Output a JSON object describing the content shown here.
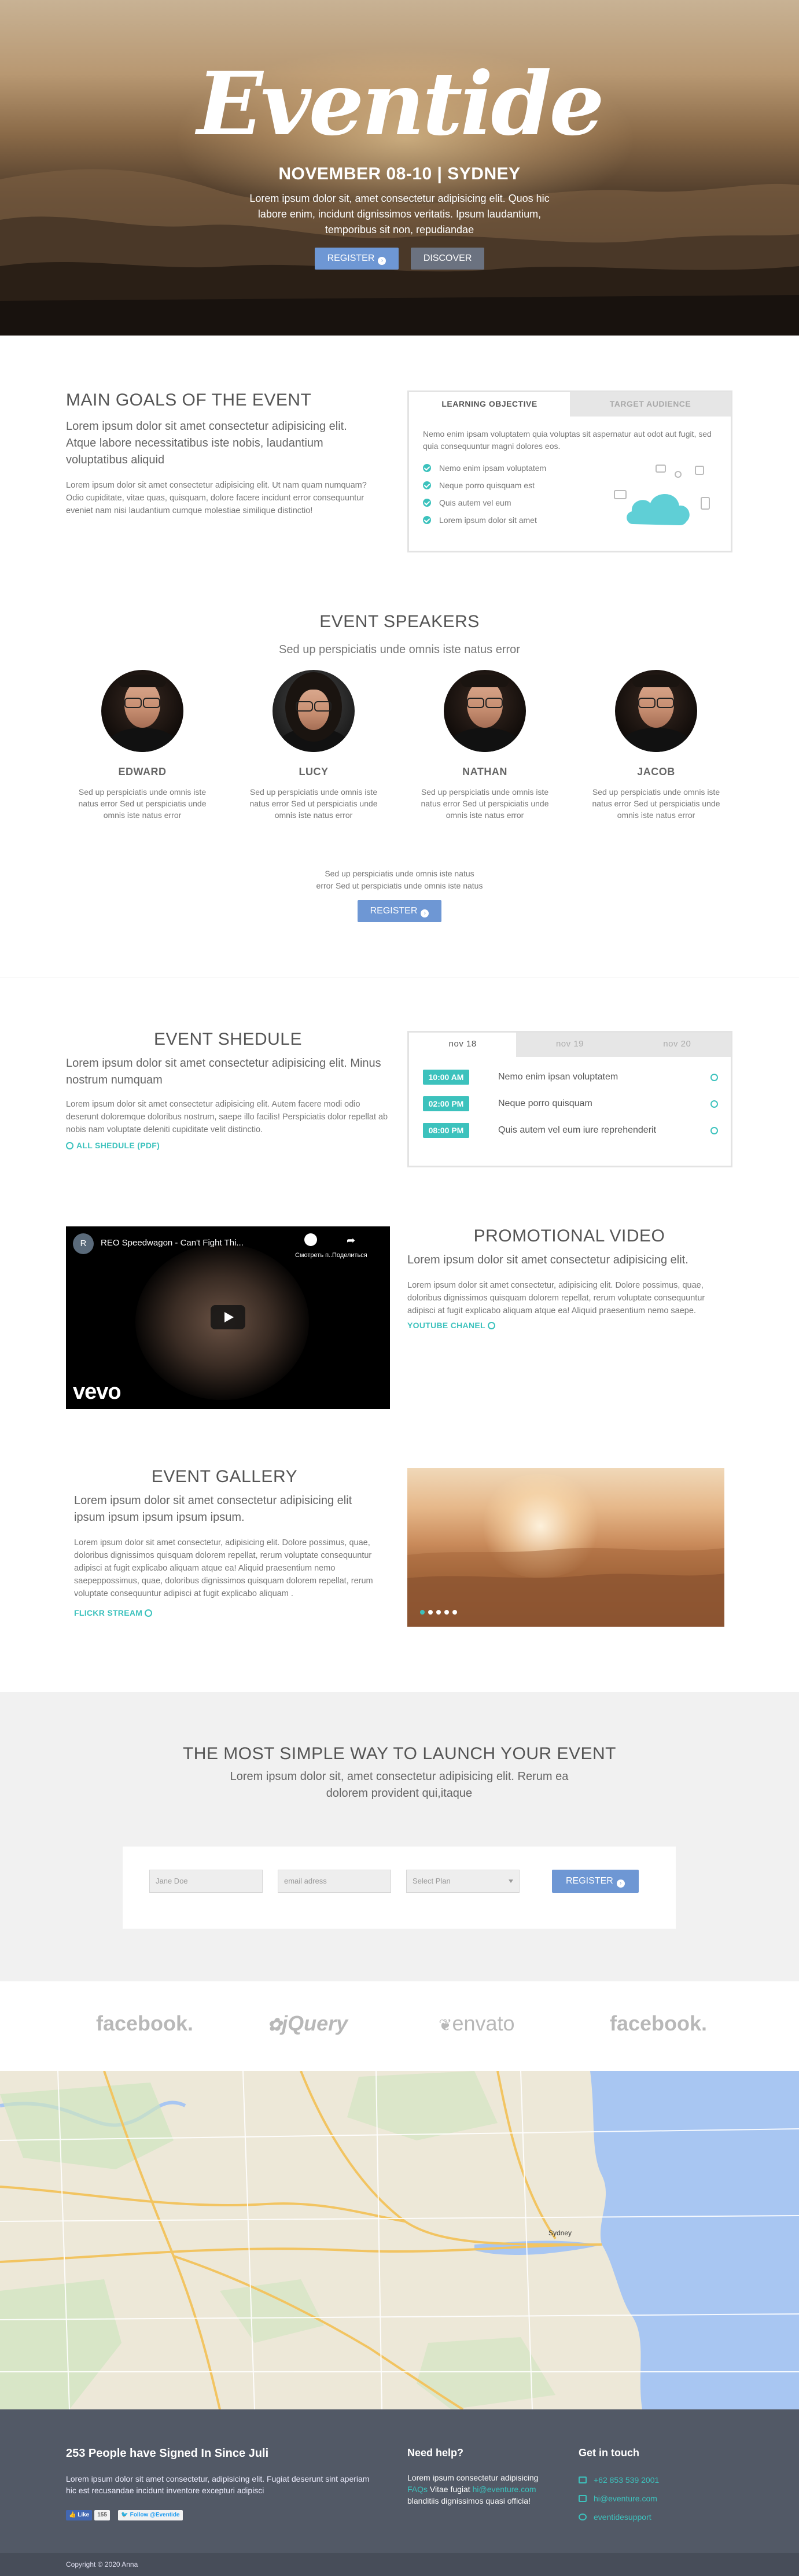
{
  "hero": {
    "logo": "Eventide",
    "date": "NOVEMBER 08-10 | SYDNEY",
    "subtitle": "Lorem ipsum dolor sit, amet consectetur adipisicing elit. Quos hic labore enim, incidunt dignissimos veritatis. Ipsum laudantium, temporibus sit non, repudiandae",
    "register": "REGISTER",
    "discover": "DISCOVER"
  },
  "goals": {
    "title": "MAIN GOALS OF THE EVENT",
    "lead": "Lorem ipsum dolor sit amet consectetur adipisicing elit. Atque labore necessitatibus iste nobis, laudantium voluptatibus aliquid",
    "body": "Lorem ipsum dolor sit amet consectetur adipisicing elit. Ut nam quam numquam? Odio cupiditate, vitae quas, quisquam, dolore facere incidunt error consequuntur eveniet nam nisi laudantium cumque molestiae similique distinctio!",
    "tabs": [
      "LEARNING OBJECTIVE",
      "TARGET AUDIENCE"
    ],
    "intro": "Nemo enim ipsam voluptatem quia voluptas sit aspernatur aut odot aut fugit, sed quia consequuntur magni dolores eos.",
    "items": [
      "Nemo enim ipsam voluptatem",
      "Neque porro quisquam est",
      "Quis autem vel eum",
      "Lorem ipsum dolor sit amet"
    ]
  },
  "speakers": {
    "title": "EVENT SPEAKERS",
    "subtitle": "Sed up perspiciatis unde omnis iste natus error",
    "people": [
      {
        "name": "EDWARD",
        "desc": "Sed up perspiciatis unde omnis iste natus error Sed ut perspiciatis unde omnis iste natus error"
      },
      {
        "name": "LUCY",
        "desc": "Sed up perspiciatis unde omnis iste natus error Sed ut perspiciatis unde omnis iste natus error"
      },
      {
        "name": "NATHAN",
        "desc": "Sed up perspiciatis unde omnis iste natus error Sed ut perspiciatis unde omnis iste natus error"
      },
      {
        "name": "JACOB",
        "desc": "Sed up perspiciatis unde omnis iste natus error Sed ut perspiciatis unde omnis iste natus error"
      }
    ],
    "bottom_line1": "Sed up perspiciatis unde omnis iste natus",
    "bottom_line2": "error Sed ut perspiciatis unde omnis iste natus",
    "register": "REGISTER"
  },
  "schedule": {
    "title": "EVENT SHEDULE",
    "lead": "Lorem ipsum dolor sit amet consectetur adipisicing elit. Minus nostrum numquam",
    "body": "Lorem ipsum dolor sit amet consectetur adipisicing elit. Autem facere modi odio deserunt doloremque doloribus nostrum, saepe illo facilis! Perspiciatis dolor repellat ab nobis nam voluptate deleniti cupiditate velit distinctio.",
    "link": "ALL SHEDULE (PDF)",
    "tabs": [
      "nov 18",
      "nov 19",
      "nov 20"
    ],
    "rows": [
      {
        "time": "10:00 AM",
        "title": "Nemo enim ipsan voluptatem"
      },
      {
        "time": "02:00 PM",
        "title": "Neque porro quisquam"
      },
      {
        "time": "08:00 PM",
        "title": "Quis autem vel eum iure reprehenderit"
      }
    ]
  },
  "video": {
    "title": "PROMOTIONAL VIDEO",
    "lead": "Lorem ipsum dolor sit amet consectetur adipisicing elit.",
    "body": "Lorem ipsum dolor sit amet consectetur, adipisicing elit. Dolore possimus, quae, doloribus dignissimos quisquam dolorem repellat, rerum voluptate consequuntur adipisci at fugit explicabo aliquam atque ea! Aliquid praesentium nemo saepe.",
    "link": "YOUTUBE CHANEL",
    "player_title": "REO Speedwagon - Can't Fight Thi...",
    "player_channel_initial": "R",
    "player_watch": "Смотреть п...",
    "player_share": "Поделиться",
    "player_brand": "vevo"
  },
  "gallery": {
    "title": "EVENT GALLERY",
    "lead": "Lorem ipsum dolor sit amet consectetur adipisicing elit ipsum ipsum ipsum ipsum ipsum.",
    "body": "Lorem ipsum dolor sit amet consectetur, adipisicing elit. Dolore possimus, quae, doloribus dignissimos quisquam dolorem repellat, rerum voluptate consequuntur adipisci at fugit explicabo aliquam atque ea! Aliquid praesentium nemo saepeppossimus, quae, doloribus dignissimos quisquam dolorem repellat, rerum voluptate consequuntur adipisci at fugit explicabo aliquam .",
    "link": "FLICKR STREAM",
    "slides": 5,
    "active_slide": 1
  },
  "launch": {
    "title": "THE MOST SIMPLE WAY TO LAUNCH YOUR EVENT",
    "lead": "Lorem ipsum dolor sit, amet consectetur adipisicing elit. Rerum ea dolorem provident qui,itaque",
    "name_placeholder": "Jane Doe",
    "email_placeholder": "email adress",
    "plan_placeholder": "Select Plan",
    "register": "REGISTER"
  },
  "logos": [
    "facebook.",
    "jQuery",
    "envato",
    "facebook."
  ],
  "map": {
    "city_label": "Sydney"
  },
  "footer": {
    "signed_title": "253 People have Signed In Since Juli",
    "signed_text": "Lorem ipsum dolor sit amet consectetur, adipisicing elit. Fugiat deserunt sint aperiam hic est recusandae incidunt inventore excepturi adipisci",
    "like": "Like",
    "like_count": "155",
    "follow": "Follow @Eventide",
    "help_title": "Need help?",
    "help_text_1": "Lorem ipsum consectetur adipisicing",
    "help_link_faqs": "FAQs",
    "help_text_2": "Vitae fugiat",
    "help_email": "hi@eventure.com",
    "help_text_3": "blanditiis dignissimos quasi officia!",
    "contact_title": "Get in touch",
    "contacts": [
      "+62 853 539 2001",
      "hi@eventure.com",
      "eventidesupport"
    ],
    "copyright": "Copyright © 2020 Anna"
  },
  "colors": {
    "accent_teal": "#3cc2bd",
    "button_blue": "#6e97d4",
    "footer_bg": "#525966"
  }
}
